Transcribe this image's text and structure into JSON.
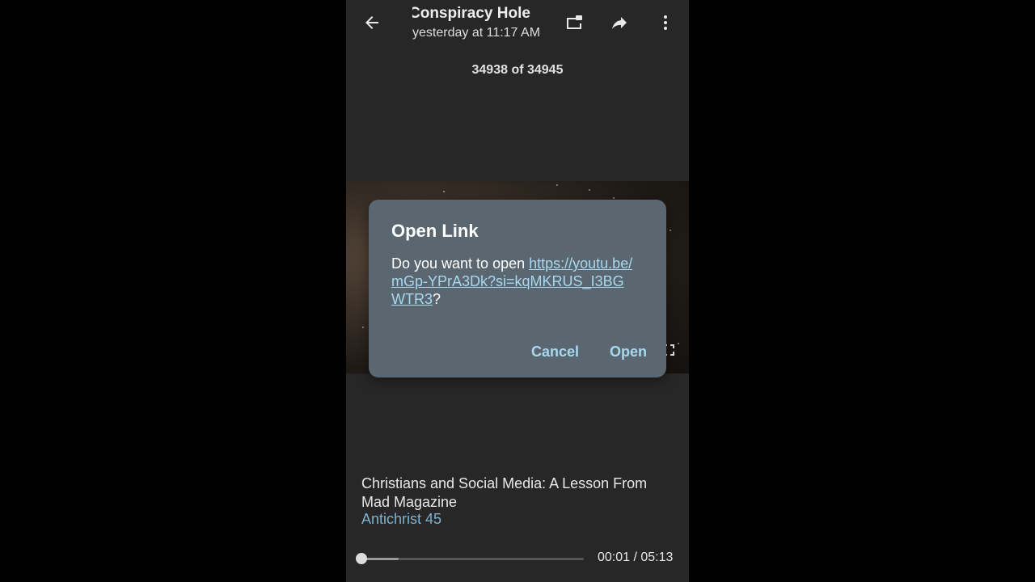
{
  "header": {
    "channel_title": "Conspiracy Hole",
    "posted": "yesterday at 11:17 AM",
    "icons": [
      "back-arrow-icon",
      "picture-in-picture-icon",
      "share-icon",
      "more-vert-icon"
    ]
  },
  "counter": "34938 of 34945",
  "dialog": {
    "title": "Open Link",
    "prompt": "Do you want to open ",
    "url": "https://youtu.be/mGp-YPrA3Dk?si=kqMKRUS_I3BGWTR3",
    "suffix": "?",
    "cancel_label": "Cancel",
    "open_label": "Open"
  },
  "video": {
    "title": "Christians and Social Media: A Lesson From Mad Magazine",
    "author": "Antichrist 45",
    "time": "00:01 / 05:13",
    "played_fraction": 0.003,
    "buffered_fraction": 0.17
  },
  "colors": {
    "accent": "#a8d8f0",
    "author": "#7fb1cf",
    "dialog_bg": "#5b6770",
    "screen_bg": "#272727"
  }
}
